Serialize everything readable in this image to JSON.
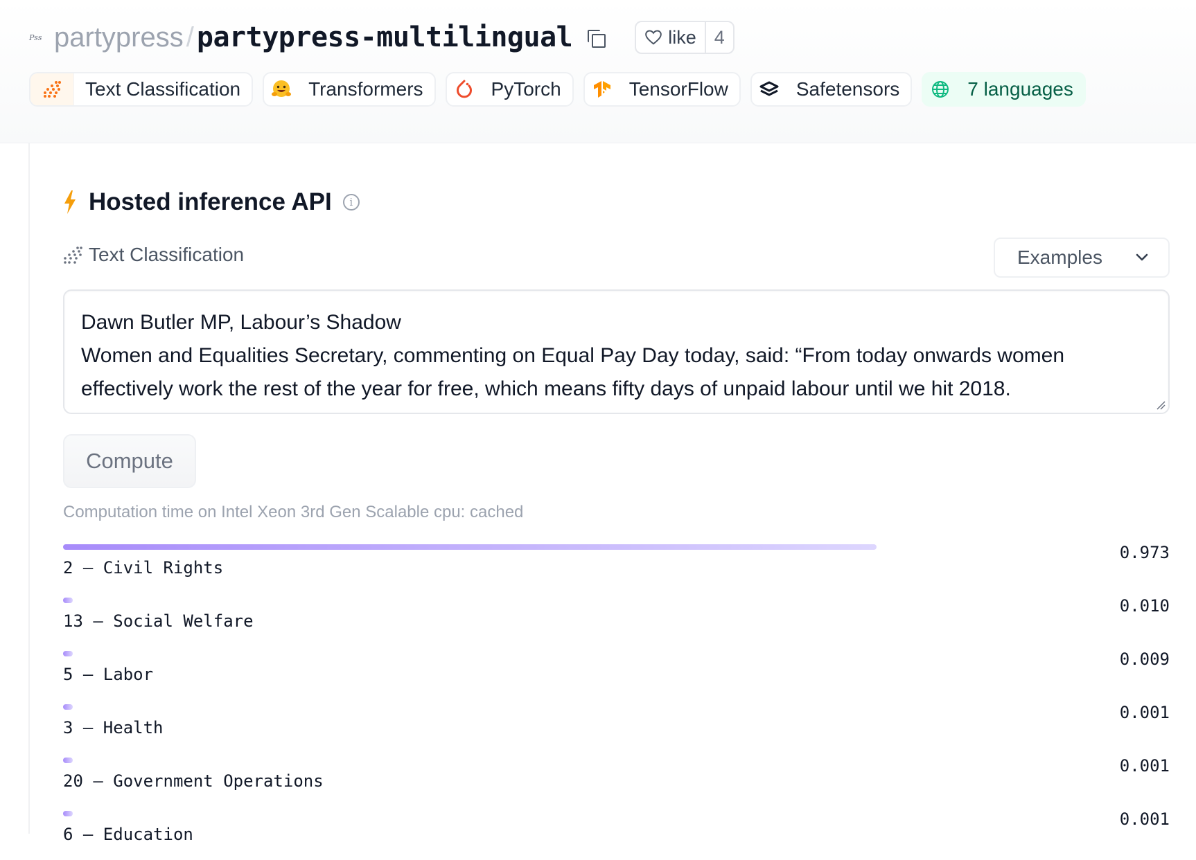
{
  "header": {
    "org_logo_text": "Pss",
    "org": "partypress",
    "separator": "/",
    "repo": "partypress-multilingual",
    "like_label": "like",
    "like_count": "4"
  },
  "tags": [
    {
      "label": "Text Classification",
      "icon": "text-classification-icon"
    },
    {
      "label": "Transformers",
      "icon": "hugging-face-icon"
    },
    {
      "label": "PyTorch",
      "icon": "pytorch-icon"
    },
    {
      "label": "TensorFlow",
      "icon": "tensorflow-icon"
    },
    {
      "label": "Safetensors",
      "icon": "safetensors-icon"
    },
    {
      "label": "7 languages",
      "icon": "globe-icon"
    }
  ],
  "inference": {
    "title": "Hosted inference API",
    "info_glyph": "i",
    "task": "Text Classification",
    "examples_label": "Examples",
    "input_lines": [
      "Dawn Butler MP, Labour’s Shadow",
      "Women and Equalities Secretary, commenting on Equal Pay Day today, said: “From today onwards women",
      "effectively work the rest of the year for free, which means fifty days of unpaid labour until we hit 2018."
    ],
    "compute_label": "Compute",
    "computation_time": "Computation time on Intel Xeon 3rd Gen Scalable cpu: cached"
  },
  "results": [
    {
      "label": "2 – Civil Rights",
      "score": 0.973,
      "score_text": "0.973"
    },
    {
      "label": "13 – Social Welfare",
      "score": 0.01,
      "score_text": "0.010"
    },
    {
      "label": "5 – Labor",
      "score": 0.009,
      "score_text": "0.009"
    },
    {
      "label": "3 – Health",
      "score": 0.001,
      "score_text": "0.001"
    },
    {
      "label": "20 – Government Operations",
      "score": 0.001,
      "score_text": "0.001"
    },
    {
      "label": "6 – Education",
      "score": 0.001,
      "score_text": "0.001"
    }
  ],
  "colors": {
    "accent_bar_start": "#a78bfa",
    "accent_bar_end": "#ddd6fe",
    "bolt": "#f59e0b",
    "language_tag_bg": "#ecfdf5",
    "language_tag_text": "#065f46"
  }
}
